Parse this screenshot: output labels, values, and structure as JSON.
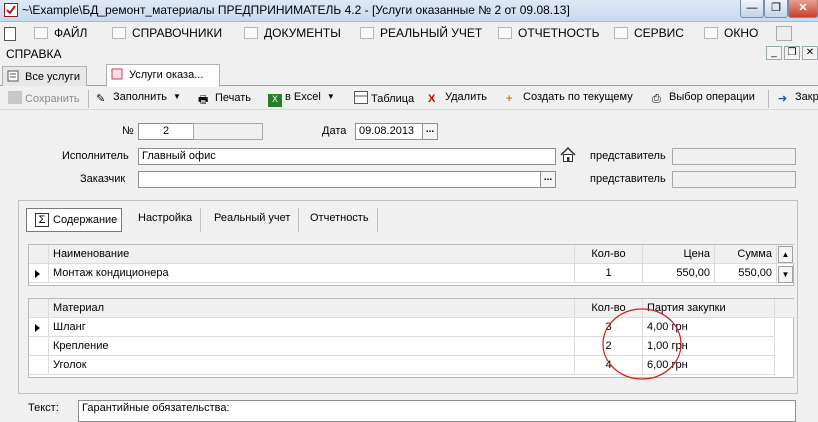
{
  "window": {
    "title": "~\\Example\\БД_ремонт_материалы  ПРЕДПРИНИМАТЕЛЬ 4.2 - [Услуги оказанные № 2 от 09.08.13]",
    "minimize": "—",
    "restore": "❐",
    "close": "✕"
  },
  "menu": {
    "items": [
      {
        "label": "ФАЙЛ",
        "icon": "folder-icon"
      },
      {
        "label": "СПРАВОЧНИКИ",
        "icon": "house-icon"
      },
      {
        "label": "ДОКУМЕНТЫ",
        "icon": "document-icon"
      },
      {
        "label": "РЕАЛЬНЫЙ УЧЕТ",
        "icon": "ledger-icon"
      },
      {
        "label": "ОТЧЕТНОСТЬ",
        "icon": "report-icon"
      },
      {
        "label": "СЕРВИС",
        "icon": "service-icon"
      },
      {
        "label": "ОКНО",
        "icon": "window-icon"
      }
    ],
    "help": "СПРАВКА",
    "mdi_minimize": "_",
    "mdi_restore": "❐",
    "mdi_close": "✕"
  },
  "doc_tabs": [
    {
      "label": "Все услуги",
      "icon": "list-icon"
    },
    {
      "label": "Услуги оказа...",
      "icon": "document-icon"
    }
  ],
  "toolbar": {
    "save": "Сохранить",
    "fill": "Заполнить",
    "print": "Печать",
    "excel": "в Excel",
    "table": "Таблица",
    "delete": "Удалить",
    "create_from_current": "Создать по текущему",
    "select_operation": "Выбор операции",
    "close": "Закр"
  },
  "form": {
    "number_label": "№",
    "number_value": "2",
    "number_extra": "",
    "date_label": "Дата",
    "date_value": "09.08.2013",
    "ellipsis": "...",
    "executor_label": "Исполнитель",
    "executor_value": "Главный офис",
    "customer_label": "Заказчик",
    "customer_value": "",
    "representative_label": "представитель",
    "representative_value_1": "",
    "representative_value_2": ""
  },
  "inner_tabs": [
    {
      "label": "Содержание",
      "icon": "sigma-icon"
    },
    {
      "label": "Настройка"
    },
    {
      "label": "Реальный учет"
    },
    {
      "label": "Отчетность"
    }
  ],
  "services_table": {
    "columns": [
      "Наименование",
      "Кол-во",
      "Цена",
      "Сумма"
    ],
    "rows": [
      [
        "Монтаж кондиционера",
        "1",
        "550,00",
        "550,00"
      ]
    ]
  },
  "materials_table": {
    "columns": [
      "Материал",
      "Кол-во",
      "Партия закупки"
    ],
    "rows": [
      [
        "Шланг",
        "3",
        "4,00 грн"
      ],
      [
        "Крепление",
        "2",
        "1,00 грн"
      ],
      [
        "Уголок",
        "4",
        "6,00 грн"
      ]
    ]
  },
  "text_section": {
    "label": "Текст:",
    "value": "Гарантийные обязательства:"
  },
  "colors": {
    "annotation_circle": "#cc2222",
    "window_close": "#c7402c"
  }
}
